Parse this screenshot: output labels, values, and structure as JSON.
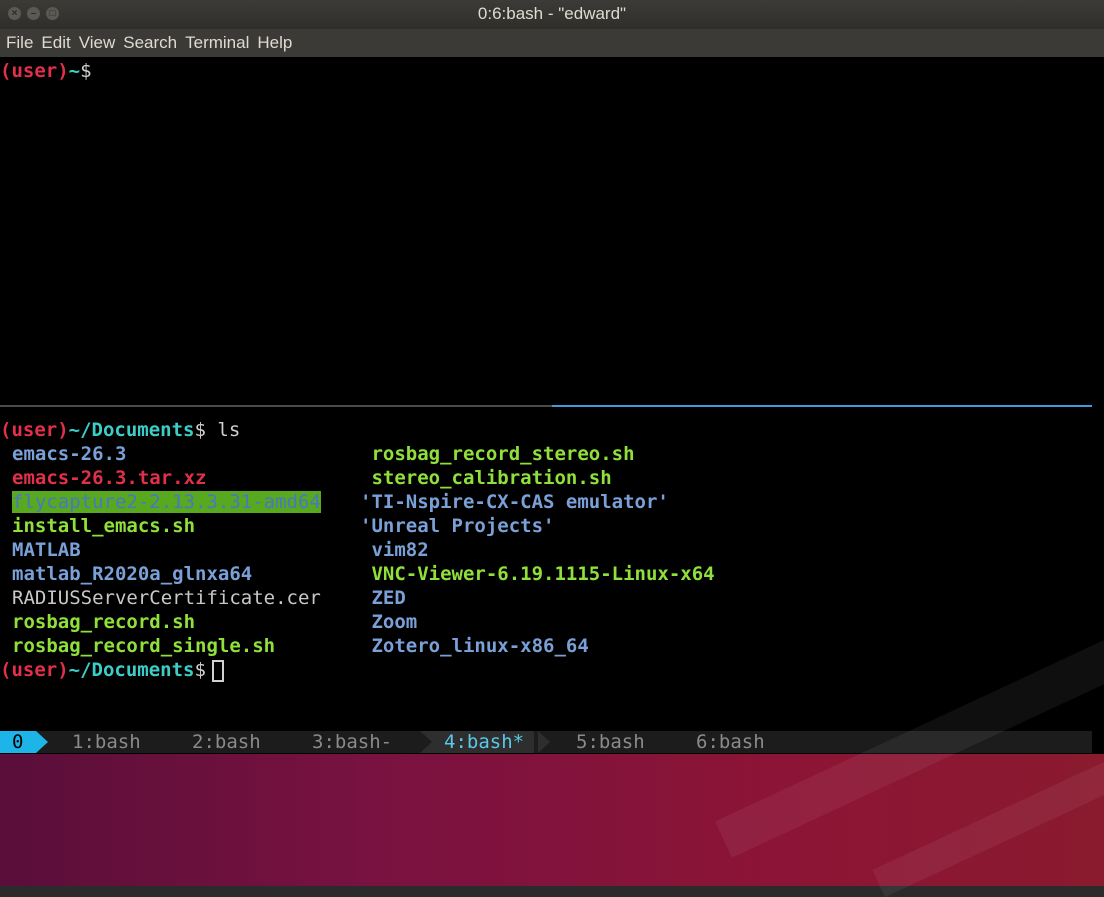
{
  "window": {
    "title": "0:6:bash - \"edward\"",
    "buttons": [
      "close",
      "minimize",
      "maximize"
    ]
  },
  "menu": [
    "File",
    "Edit",
    "View",
    "Search",
    "Terminal",
    "Help"
  ],
  "top_pane": {
    "prompt_user": "(user)",
    "prompt_path": "~",
    "prompt_symbol": "$"
  },
  "bottom_pane": {
    "prompt_user": "(user)",
    "prompt_path": "~/Documents",
    "prompt_symbol": "$",
    "command": " ls",
    "left_column": [
      {
        "text": "emacs-26.3",
        "color": "blue"
      },
      {
        "text": "emacs-26.3.tar.xz",
        "color": "red"
      },
      {
        "text": "flycapture2-2.13.3.31-amd64",
        "color": "highlight"
      },
      {
        "text": "install_emacs.sh",
        "color": "green"
      },
      {
        "text": "MATLAB",
        "color": "blue"
      },
      {
        "text": "matlab_R2020a_glnxa64",
        "color": "blue"
      },
      {
        "text": "RADIUSServerCertificate.cer",
        "color": "gray"
      },
      {
        "text": "rosbag_record.sh",
        "color": "green"
      },
      {
        "text": "rosbag_record_single.sh",
        "color": "green"
      }
    ],
    "right_column": [
      {
        "text": " rosbag_record_stereo.sh",
        "color": "green"
      },
      {
        "text": " stereo_calibration.sh",
        "color": "green"
      },
      {
        "text": "'TI-Nspire-CX-CAS emulator'",
        "color": "blue"
      },
      {
        "text": "'Unreal Projects'",
        "color": "blue"
      },
      {
        "text": " vim82",
        "color": "blue"
      },
      {
        "text": " VNC-Viewer-6.19.1115-Linux-x64",
        "color": "green"
      },
      {
        "text": " ZED",
        "color": "blue"
      },
      {
        "text": " Zoom",
        "color": "blue"
      },
      {
        "text": " Zotero_linux-x86_64",
        "color": "blue"
      }
    ],
    "final_prompt_user": "(user)",
    "final_prompt_path": "~/Documents",
    "final_prompt_symbol": "$"
  },
  "status_bar": {
    "session": "0",
    "windows": [
      {
        "label": "1:bash",
        "active": false
      },
      {
        "label": "2:bash",
        "active": false
      },
      {
        "label": "3:bash-",
        "active": false
      },
      {
        "label": "4:bash*",
        "active": true
      },
      {
        "label": "5:bash",
        "active": false
      },
      {
        "label": "6:bash",
        "active": false
      }
    ]
  },
  "colors": {
    "prompt_user": "#e0304a",
    "prompt_path": "#3ccdc6",
    "directory": "#7aa0d8",
    "executable": "#8fe03a",
    "archive": "#e0304a",
    "highlight_bg": "#58a820",
    "active_window": "#5ac8e8",
    "session_badge": "#1db4e8"
  }
}
